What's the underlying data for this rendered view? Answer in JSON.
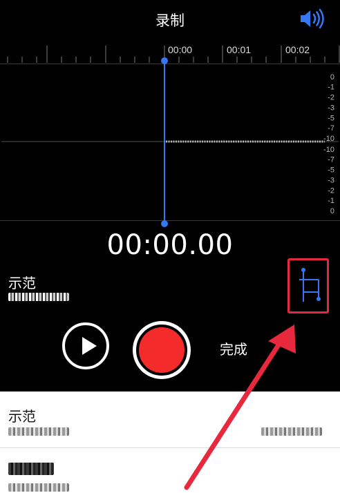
{
  "header": {
    "title": "录制",
    "speaker_icon": "speaker-volume-icon"
  },
  "timeline": {
    "labels": [
      "00:00",
      "00:01",
      "00:02"
    ]
  },
  "waveform": {
    "scale_labels": [
      "0",
      "-1",
      "-2",
      "-3",
      "-5",
      "-7",
      "-10",
      "-10",
      "-7",
      "-5",
      "-3",
      "-2",
      "-1",
      "0"
    ]
  },
  "timer": {
    "value": "00:00.00"
  },
  "recording": {
    "name": "示范"
  },
  "controls": {
    "done_label": "完成",
    "accent": "#3478f6",
    "record_color": "#f42b2b",
    "highlight_color": "#e3293f"
  },
  "list": {
    "items": [
      {
        "name": "示范"
      }
    ]
  }
}
